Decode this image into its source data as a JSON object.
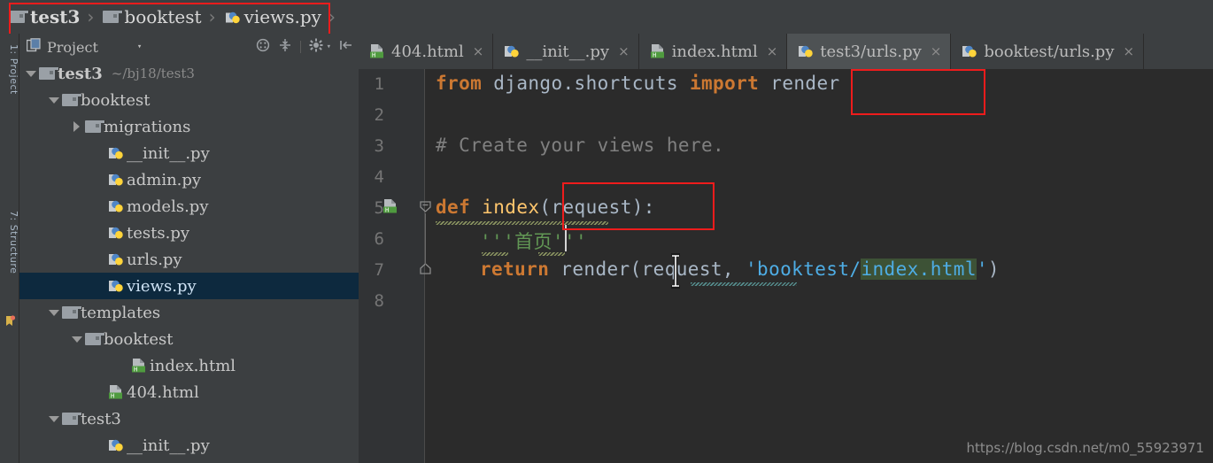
{
  "breadcrumb": {
    "items": [
      {
        "label": "test3",
        "icon": "folder-icon",
        "bold": true
      },
      {
        "label": "booktest",
        "icon": "folder-icon",
        "bold": false
      },
      {
        "label": "views.py",
        "icon": "python-file-icon",
        "bold": false
      }
    ],
    "separator": "›"
  },
  "project_panel": {
    "title": "Project",
    "caret": "▾",
    "tools": [
      "expand-all-icon",
      "collapse-all-icon",
      "settings-gear-icon",
      "hide-panel-icon"
    ],
    "vertical_labels": {
      "project": "1: Project",
      "structure": "7: Structure"
    },
    "tree": [
      {
        "label": "test3",
        "sub": "~/bj18/test3",
        "indent": 0,
        "arrow": "down",
        "icon": "folder-icon",
        "bold": true,
        "selected": false
      },
      {
        "label": "booktest",
        "sub": "",
        "indent": 1,
        "arrow": "down",
        "icon": "folder-icon",
        "bold": false,
        "selected": false
      },
      {
        "label": "migrations",
        "sub": "",
        "indent": 2,
        "arrow": "right",
        "icon": "folder-icon",
        "bold": false,
        "selected": false
      },
      {
        "label": "__init__.py",
        "sub": "",
        "indent": 3,
        "arrow": "none",
        "icon": "python-file-icon",
        "bold": false,
        "selected": false
      },
      {
        "label": "admin.py",
        "sub": "",
        "indent": 3,
        "arrow": "none",
        "icon": "python-file-icon",
        "bold": false,
        "selected": false
      },
      {
        "label": "models.py",
        "sub": "",
        "indent": 3,
        "arrow": "none",
        "icon": "python-file-icon",
        "bold": false,
        "selected": false
      },
      {
        "label": "tests.py",
        "sub": "",
        "indent": 3,
        "arrow": "none",
        "icon": "python-file-icon",
        "bold": false,
        "selected": false
      },
      {
        "label": "urls.py",
        "sub": "",
        "indent": 3,
        "arrow": "none",
        "icon": "python-file-icon",
        "bold": false,
        "selected": false
      },
      {
        "label": "views.py",
        "sub": "",
        "indent": 3,
        "arrow": "none",
        "icon": "python-file-icon",
        "bold": false,
        "selected": true
      },
      {
        "label": "templates",
        "sub": "",
        "indent": 1,
        "arrow": "down",
        "icon": "folder-icon",
        "bold": false,
        "selected": false
      },
      {
        "label": "booktest",
        "sub": "",
        "indent": 2,
        "arrow": "down",
        "icon": "folder-icon",
        "bold": false,
        "selected": false
      },
      {
        "label": "index.html",
        "sub": "",
        "indent": 4,
        "arrow": "none",
        "icon": "html-file-icon",
        "bold": false,
        "selected": false
      },
      {
        "label": "404.html",
        "sub": "",
        "indent": 3,
        "arrow": "none",
        "icon": "html-file-icon",
        "bold": false,
        "selected": false
      },
      {
        "label": "test3",
        "sub": "",
        "indent": 1,
        "arrow": "down",
        "icon": "folder-icon",
        "bold": false,
        "selected": false
      },
      {
        "label": "__init__.py",
        "sub": "",
        "indent": 3,
        "arrow": "none",
        "icon": "python-file-icon",
        "bold": false,
        "selected": false
      }
    ]
  },
  "editor": {
    "tabs": [
      {
        "label": "404.html",
        "icon": "html-file-icon",
        "active": false,
        "close": "×"
      },
      {
        "label": "__init__.py",
        "icon": "python-file-icon",
        "active": false,
        "close": "×"
      },
      {
        "label": "index.html",
        "icon": "html-file-icon",
        "active": false,
        "close": "×"
      },
      {
        "label": "test3/urls.py",
        "icon": "python-file-icon",
        "active": true,
        "close": "×"
      },
      {
        "label": "booktest/urls.py",
        "icon": "python-file-icon",
        "active": false,
        "close": "×"
      }
    ],
    "line_numbers": [
      "1",
      "2",
      "3",
      "4",
      "5",
      "6",
      "7",
      "8"
    ],
    "code": {
      "line1": {
        "kw1": "from",
        "mod": " django.shortcuts ",
        "kw2": "import",
        "name": " render"
      },
      "line3_comment": "# Create your views here.",
      "line5": {
        "kw": "def",
        "name": " index",
        "args": "(request):"
      },
      "line6_docstring": "'''首页'''",
      "line7": {
        "kw": "return",
        "call": " render(request, ",
        "q1": "'",
        "path_prefix": "booktest/",
        "path_file": "index.html",
        "q2": "'",
        "close": ")"
      }
    }
  },
  "annotations": {
    "color": "#ee1c1c",
    "boxes": [
      "breadcrumb-box",
      "render-import-box",
      "request-signature-box"
    ]
  },
  "watermark": "https://blog.csdn.net/m0_55923971"
}
